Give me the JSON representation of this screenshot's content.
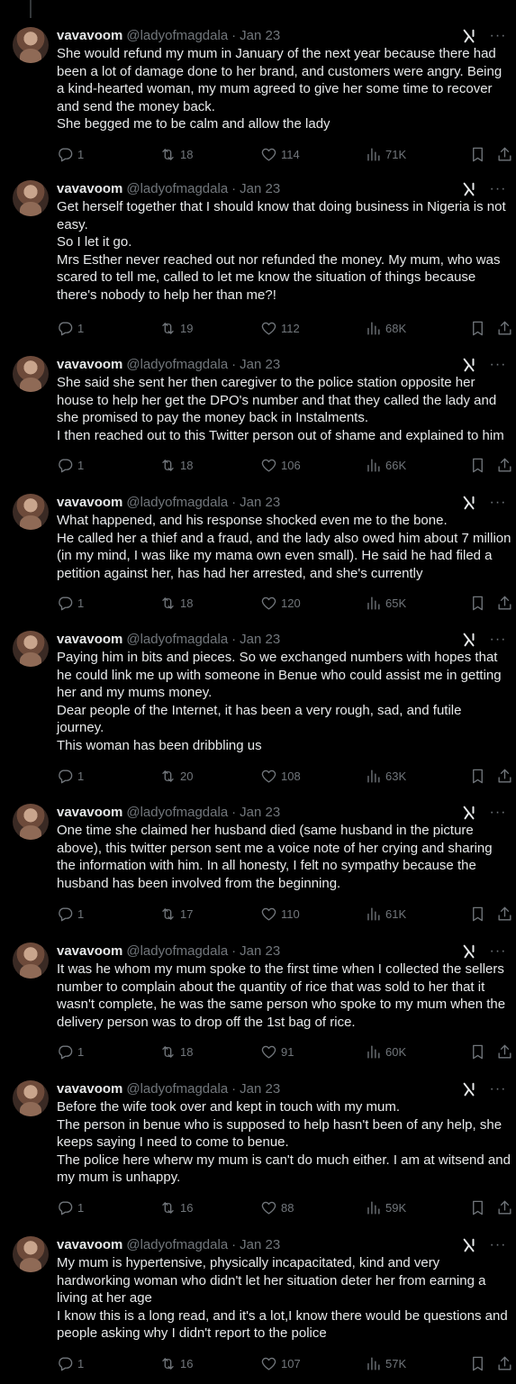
{
  "author": {
    "display_name": "vavavoom",
    "handle": "@ladyofmagdala",
    "separator": "·"
  },
  "tweets": [
    {
      "date": "Jan 23",
      "lines": [
        "She would refund my mum in January of the next year because there had been a lot of damage done to her brand, and customers were angry. Being a kind-hearted woman, my mum agreed to give her some time to recover and send the money back.",
        "She begged me to be calm and allow the lady"
      ],
      "replies": "1",
      "reposts": "18",
      "likes": "114",
      "views": "71K"
    },
    {
      "date": "Jan 23",
      "lines": [
        "Get herself together that I should know that doing business in Nigeria is not easy.",
        "So I let it go.",
        "Mrs Esther never reached out nor refunded the money. My mum, who was scared to tell me, called to let me know the situation of things because there's nobody to help her than me?!"
      ],
      "replies": "1",
      "reposts": "19",
      "likes": "112",
      "views": "68K"
    },
    {
      "date": "Jan 23",
      "lines": [
        "She said she sent her then caregiver to the police station opposite her house to help her get the DPO's number and that they called the lady and she promised to pay the money back in Instalments.",
        "I then reached out to this Twitter person out of shame and explained to him"
      ],
      "replies": "1",
      "reposts": "18",
      "likes": "106",
      "views": "66K"
    },
    {
      "date": "Jan 23",
      "lines": [
        "What happened, and his response shocked even me to the bone.",
        "He called her a thief and a fraud, and the lady also owed him about 7 million (in my mind, I was like my mama own even small). He said he had filed a petition against her, has had her arrested, and she's currently"
      ],
      "replies": "1",
      "reposts": "18",
      "likes": "120",
      "views": "65K"
    },
    {
      "date": "Jan 23",
      "lines": [
        "Paying him in bits and pieces. So we exchanged numbers with hopes that he could link me up with someone in Benue who could assist me in getting her and my mums money.",
        "Dear people of the Internet, it has been a very rough, sad, and futile journey.",
        "This woman has been dribbling us"
      ],
      "replies": "1",
      "reposts": "20",
      "likes": "108",
      "views": "63K"
    },
    {
      "date": "Jan 23",
      "lines": [
        "One time she claimed her husband died (same husband in the picture above), this twitter person sent me a voice note of her crying and sharing the information with him. In all honesty, I felt no sympathy because the husband has been involved from the beginning."
      ],
      "replies": "1",
      "reposts": "17",
      "likes": "110",
      "views": "61K"
    },
    {
      "date": "Jan 23",
      "lines": [
        "It was he whom my mum spoke to the first time when I collected the sellers number to complain about the quantity of rice that was sold to her that it wasn't complete, he was the same person who spoke to my mum when the delivery person was to drop off the 1st bag of rice."
      ],
      "replies": "1",
      "reposts": "18",
      "likes": "91",
      "views": "60K"
    },
    {
      "date": "Jan 23",
      "lines": [
        "Before the wife took over and kept in touch with my mum.",
        "The person in benue who is supposed to help hasn't been of any help, she keeps saying I need to come to benue.",
        "The police here wherw my mum is can't do much either.  I am at witsend and my mum is unhappy."
      ],
      "replies": "1",
      "reposts": "16",
      "likes": "88",
      "views": "59K"
    },
    {
      "date": "Jan 23",
      "lines": [
        "My mum is hypertensive, physically incapacitated, kind and very hardworking woman who didn't let her situation deter her from earning a living at her age",
        "I know this is a long read, and it's a lot,I know there would be questions and people asking why I didn't report to the police"
      ],
      "replies": "1",
      "reposts": "16",
      "likes": "107",
      "views": "57K"
    }
  ],
  "icons": {
    "reply": "reply-icon",
    "repost": "repost-icon",
    "like": "like-icon",
    "views": "views-icon",
    "bookmark": "bookmark-icon",
    "share": "share-icon",
    "grok": "grok-icon",
    "more": "more-icon"
  },
  "colors": {
    "background": "#000000",
    "text": "#e7e9ea",
    "muted": "#71767b",
    "thread_line": "#333639"
  }
}
